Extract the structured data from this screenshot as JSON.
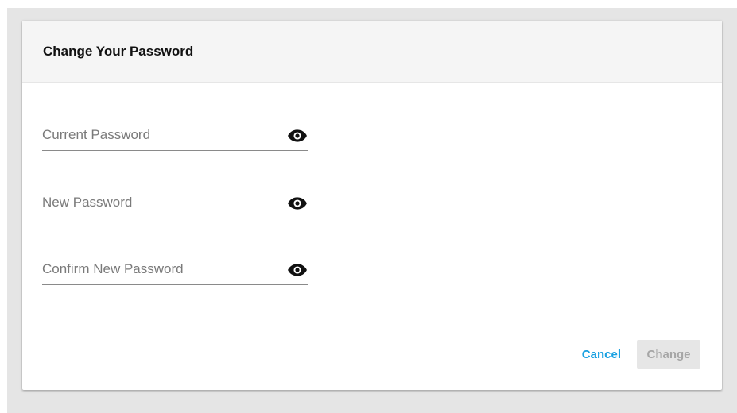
{
  "dialog": {
    "title": "Change Your Password",
    "fields": [
      {
        "placeholder": "Current Password",
        "value": "",
        "icon": "eye-icon"
      },
      {
        "placeholder": "New Password",
        "value": "",
        "icon": "eye-icon"
      },
      {
        "placeholder": "Confirm New Password",
        "value": "",
        "icon": "eye-icon"
      }
    ],
    "actions": {
      "cancel_label": "Cancel",
      "change_label": "Change"
    }
  },
  "colors": {
    "accent": "#1aa1e1",
    "backdrop": "#e5e5e5",
    "header_bg": "#f5f5f5",
    "disabled_bg": "#e6e6e6",
    "disabled_text": "#a6a6a6"
  }
}
